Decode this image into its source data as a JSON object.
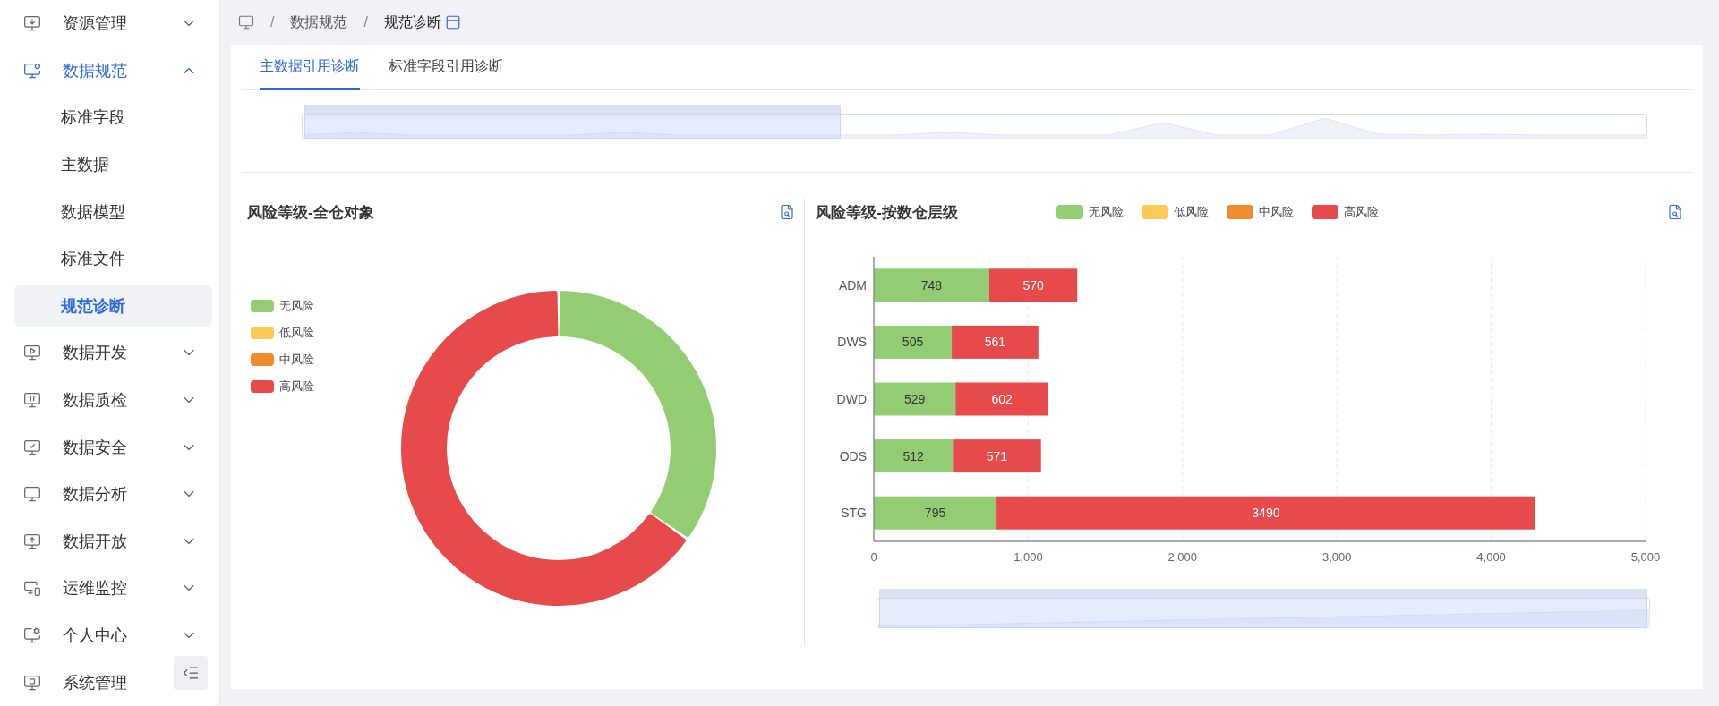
{
  "sidebar": {
    "items": [
      {
        "label": "资源管理",
        "selected": false,
        "expanded": false
      },
      {
        "label": "数据规范",
        "selected": true,
        "expanded": true,
        "children": [
          {
            "label": "标准字段",
            "selected": false
          },
          {
            "label": "主数据",
            "selected": false
          },
          {
            "label": "数据模型",
            "selected": false
          },
          {
            "label": "标准文件",
            "selected": false
          },
          {
            "label": "规范诊断",
            "selected": true
          }
        ]
      },
      {
        "label": "数据开发",
        "selected": false,
        "expanded": false
      },
      {
        "label": "数据质检",
        "selected": false,
        "expanded": false
      },
      {
        "label": "数据安全",
        "selected": false,
        "expanded": false
      },
      {
        "label": "数据分析",
        "selected": false,
        "expanded": false
      },
      {
        "label": "数据开放",
        "selected": false,
        "expanded": false
      },
      {
        "label": "运维监控",
        "selected": false,
        "expanded": false
      },
      {
        "label": "个人中心",
        "selected": false,
        "expanded": false
      },
      {
        "label": "系统管理",
        "selected": false
      }
    ]
  },
  "breadcrumb": [
    {
      "separator": "/",
      "label": "数据规范"
    },
    {
      "separator": "/",
      "label": "规范诊断"
    }
  ],
  "tabs": [
    {
      "label": "主数据引用诊断",
      "selected": true
    },
    {
      "label": "标准字段引用诊断",
      "selected": false
    }
  ],
  "top_slider": {
    "level": 0.4
  },
  "left_chart": {
    "title": "风险等级-全仓对象",
    "legend": [
      {
        "label": "无风险",
        "color": "#93cd73"
      },
      {
        "label": "低风险",
        "color": "#fbc957"
      },
      {
        "label": "中风险",
        "color": "#f08b2f"
      },
      {
        "label": "高风险",
        "color": "#e64a4a"
      }
    ]
  },
  "right_chart": {
    "title": "风险等级-按数仓层级",
    "chart_data": {
      "type": "bar",
      "orientation": "horizontal",
      "stacked": true,
      "grid": true,
      "categories": [
        "ADM",
        "DWS",
        "DWD",
        "ODS",
        "STG"
      ],
      "series": [
        {
          "name": "无风险",
          "color": "#93cd73",
          "values": [
            748,
            505,
            529,
            512,
            795
          ]
        },
        {
          "name": "低风险",
          "color": "#fbc957",
          "values": [
            null,
            null,
            null,
            null,
            null
          ]
        },
        {
          "name": "中风险",
          "color": "#f08b2f",
          "values": [
            null,
            null,
            null,
            null,
            null
          ]
        },
        {
          "name": "高风险",
          "color": "#e64a4a",
          "values": [
            570,
            561,
            602,
            571,
            3490
          ]
        }
      ],
      "xlim": [
        0,
        5000
      ],
      "xticks": [
        {
          "value": 0,
          "label": "0"
        },
        {
          "value": 1000,
          "label": "1,000"
        },
        {
          "value": 2000,
          "label": "2,000"
        },
        {
          "value": 3000,
          "label": "3,000"
        },
        {
          "value": 4000,
          "label": "4,000"
        },
        {
          "value": 5000,
          "label": "5,000"
        }
      ],
      "data_labels": true
    },
    "slider": {
      "level": 1
    }
  }
}
